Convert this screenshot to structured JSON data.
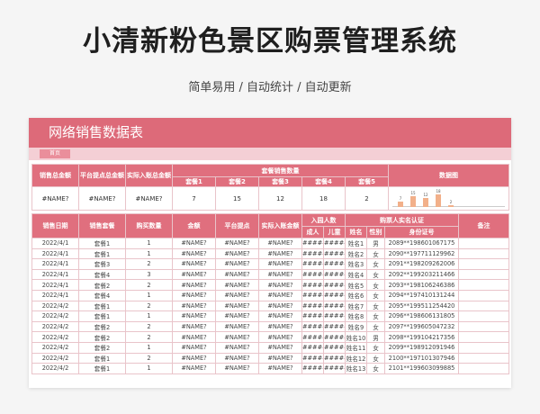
{
  "page": {
    "title": "小清新粉色景区购票管理系统",
    "subtitle": "简单易用 / 自动统计 / 自动更新"
  },
  "sheet": {
    "title": "网络销售数据表",
    "tab_label": "首页"
  },
  "summary": {
    "headers": {
      "total_sales": "销售总金额",
      "platform_fee": "平台提点总金额",
      "actual_income": "实际入账总金额",
      "package_count": "套餐销售数量",
      "chart": "数据图"
    },
    "packages": [
      "套餐1",
      "套餐2",
      "套餐3",
      "套餐4",
      "套餐5"
    ],
    "values": {
      "total_sales": "#NAME?",
      "platform_fee": "#NAME?",
      "actual_income": "#NAME?",
      "package_counts": [
        "7",
        "15",
        "12",
        "18",
        "2"
      ]
    }
  },
  "chart_data": {
    "type": "bar",
    "categories": [
      "套餐1",
      "套餐2",
      "套餐3",
      "套餐4",
      "套餐5"
    ],
    "values": [
      7,
      15,
      12,
      18,
      2
    ],
    "ylim": [
      0,
      18
    ]
  },
  "detail": {
    "headers": {
      "date": "销售日期",
      "package": "销售套餐",
      "qty": "购买数量",
      "amount": "金额",
      "platform": "平台提点",
      "actual": "实际入账金额",
      "entry": "入园人数",
      "adult": "成人",
      "child": "儿童",
      "realname": "购票人实名认证",
      "name": "姓名",
      "gender": "性别",
      "id_no": "身份证号",
      "remark": "备注"
    },
    "rows": [
      {
        "date": "2022/4/1",
        "pkg": "套餐1",
        "qty": "1",
        "amount": "#NAME?",
        "platform": "#NAME?",
        "actual": "#NAME?",
        "adult": "######",
        "child": "######",
        "name": "姓名1",
        "gender": "男",
        "id": "2089**198601067175"
      },
      {
        "date": "2022/4/1",
        "pkg": "套餐1",
        "qty": "1",
        "amount": "#NAME?",
        "platform": "#NAME?",
        "actual": "#NAME?",
        "adult": "######",
        "child": "######",
        "name": "姓名2",
        "gender": "女",
        "id": "2090**197711129962"
      },
      {
        "date": "2022/4/1",
        "pkg": "套餐3",
        "qty": "2",
        "amount": "#NAME?",
        "platform": "#NAME?",
        "actual": "#NAME?",
        "adult": "######",
        "child": "######",
        "name": "姓名3",
        "gender": "女",
        "id": "2091**198209262006"
      },
      {
        "date": "2022/4/1",
        "pkg": "套餐4",
        "qty": "3",
        "amount": "#NAME?",
        "platform": "#NAME?",
        "actual": "#NAME?",
        "adult": "######",
        "child": "######",
        "name": "姓名4",
        "gender": "女",
        "id": "2092**199203211466"
      },
      {
        "date": "2022/4/1",
        "pkg": "套餐2",
        "qty": "2",
        "amount": "#NAME?",
        "platform": "#NAME?",
        "actual": "#NAME?",
        "adult": "######",
        "child": "######",
        "name": "姓名5",
        "gender": "女",
        "id": "2093**198106246386"
      },
      {
        "date": "2022/4/1",
        "pkg": "套餐4",
        "qty": "1",
        "amount": "#NAME?",
        "platform": "#NAME?",
        "actual": "#NAME?",
        "adult": "######",
        "child": "######",
        "name": "姓名6",
        "gender": "女",
        "id": "2094**197410131244"
      },
      {
        "date": "2022/4/2",
        "pkg": "套餐1",
        "qty": "2",
        "amount": "#NAME?",
        "platform": "#NAME?",
        "actual": "#NAME?",
        "adult": "######",
        "child": "######",
        "name": "姓名7",
        "gender": "女",
        "id": "2095**199511254420"
      },
      {
        "date": "2022/4/2",
        "pkg": "套餐1",
        "qty": "1",
        "amount": "#NAME?",
        "platform": "#NAME?",
        "actual": "#NAME?",
        "adult": "######",
        "child": "######",
        "name": "姓名8",
        "gender": "女",
        "id": "2096**198606131805"
      },
      {
        "date": "2022/4/2",
        "pkg": "套餐2",
        "qty": "2",
        "amount": "#NAME?",
        "platform": "#NAME?",
        "actual": "#NAME?",
        "adult": "######",
        "child": "######",
        "name": "姓名9",
        "gender": "女",
        "id": "2097**199605047232"
      },
      {
        "date": "2022/4/2",
        "pkg": "套餐2",
        "qty": "2",
        "amount": "#NAME?",
        "platform": "#NAME?",
        "actual": "#NAME?",
        "adult": "######",
        "child": "######",
        "name": "姓名10",
        "gender": "男",
        "id": "2098**199104217356"
      },
      {
        "date": "2022/4/2",
        "pkg": "套餐2",
        "qty": "1",
        "amount": "#NAME?",
        "platform": "#NAME?",
        "actual": "#NAME?",
        "adult": "######",
        "child": "######",
        "name": "姓名11",
        "gender": "女",
        "id": "2099**198912091946"
      },
      {
        "date": "2022/4/2",
        "pkg": "套餐1",
        "qty": "2",
        "amount": "#NAME?",
        "platform": "#NAME?",
        "actual": "#NAME?",
        "adult": "######",
        "child": "######",
        "name": "姓名12",
        "gender": "女",
        "id": "2100**197101307946"
      },
      {
        "date": "2022/4/2",
        "pkg": "套餐1",
        "qty": "1",
        "amount": "#NAME?",
        "platform": "#NAME?",
        "actual": "#NAME?",
        "adult": "######",
        "child": "######",
        "name": "姓名13",
        "gender": "女",
        "id": "2101**199603099885"
      }
    ]
  }
}
